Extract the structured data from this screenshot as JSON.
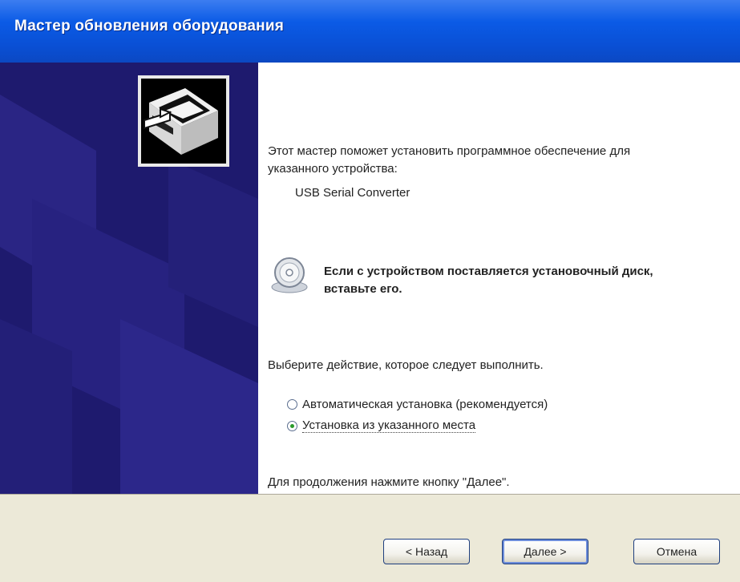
{
  "window": {
    "title": "Мастер обновления оборудования"
  },
  "content": {
    "intro": "Этот мастер поможет установить программное обеспечение для указанного устройства:",
    "device_name": "USB Serial Converter",
    "cd_note": "Если с устройством поставляется установочный диск, вставьте его.",
    "choose_prompt": "Выберите действие, которое следует выполнить.",
    "options": [
      {
        "label": "Автоматическая установка (рекомендуется)",
        "selected": false
      },
      {
        "label": "Установка из указанного места",
        "selected": true
      }
    ],
    "continue_note": "Для продолжения нажмите кнопку \"Далее\"."
  },
  "buttons": {
    "back": "< Назад",
    "next": "Далее >",
    "cancel": "Отмена"
  },
  "icons": {
    "wizard": "hardware-wizard-icon",
    "cd": "cd-icon"
  },
  "colors": {
    "title_bar": "#0b5be6",
    "left_panel": "#1e1a6e",
    "dialog_background": "#ece9d8",
    "radio_dot": "#2b9b2b"
  }
}
